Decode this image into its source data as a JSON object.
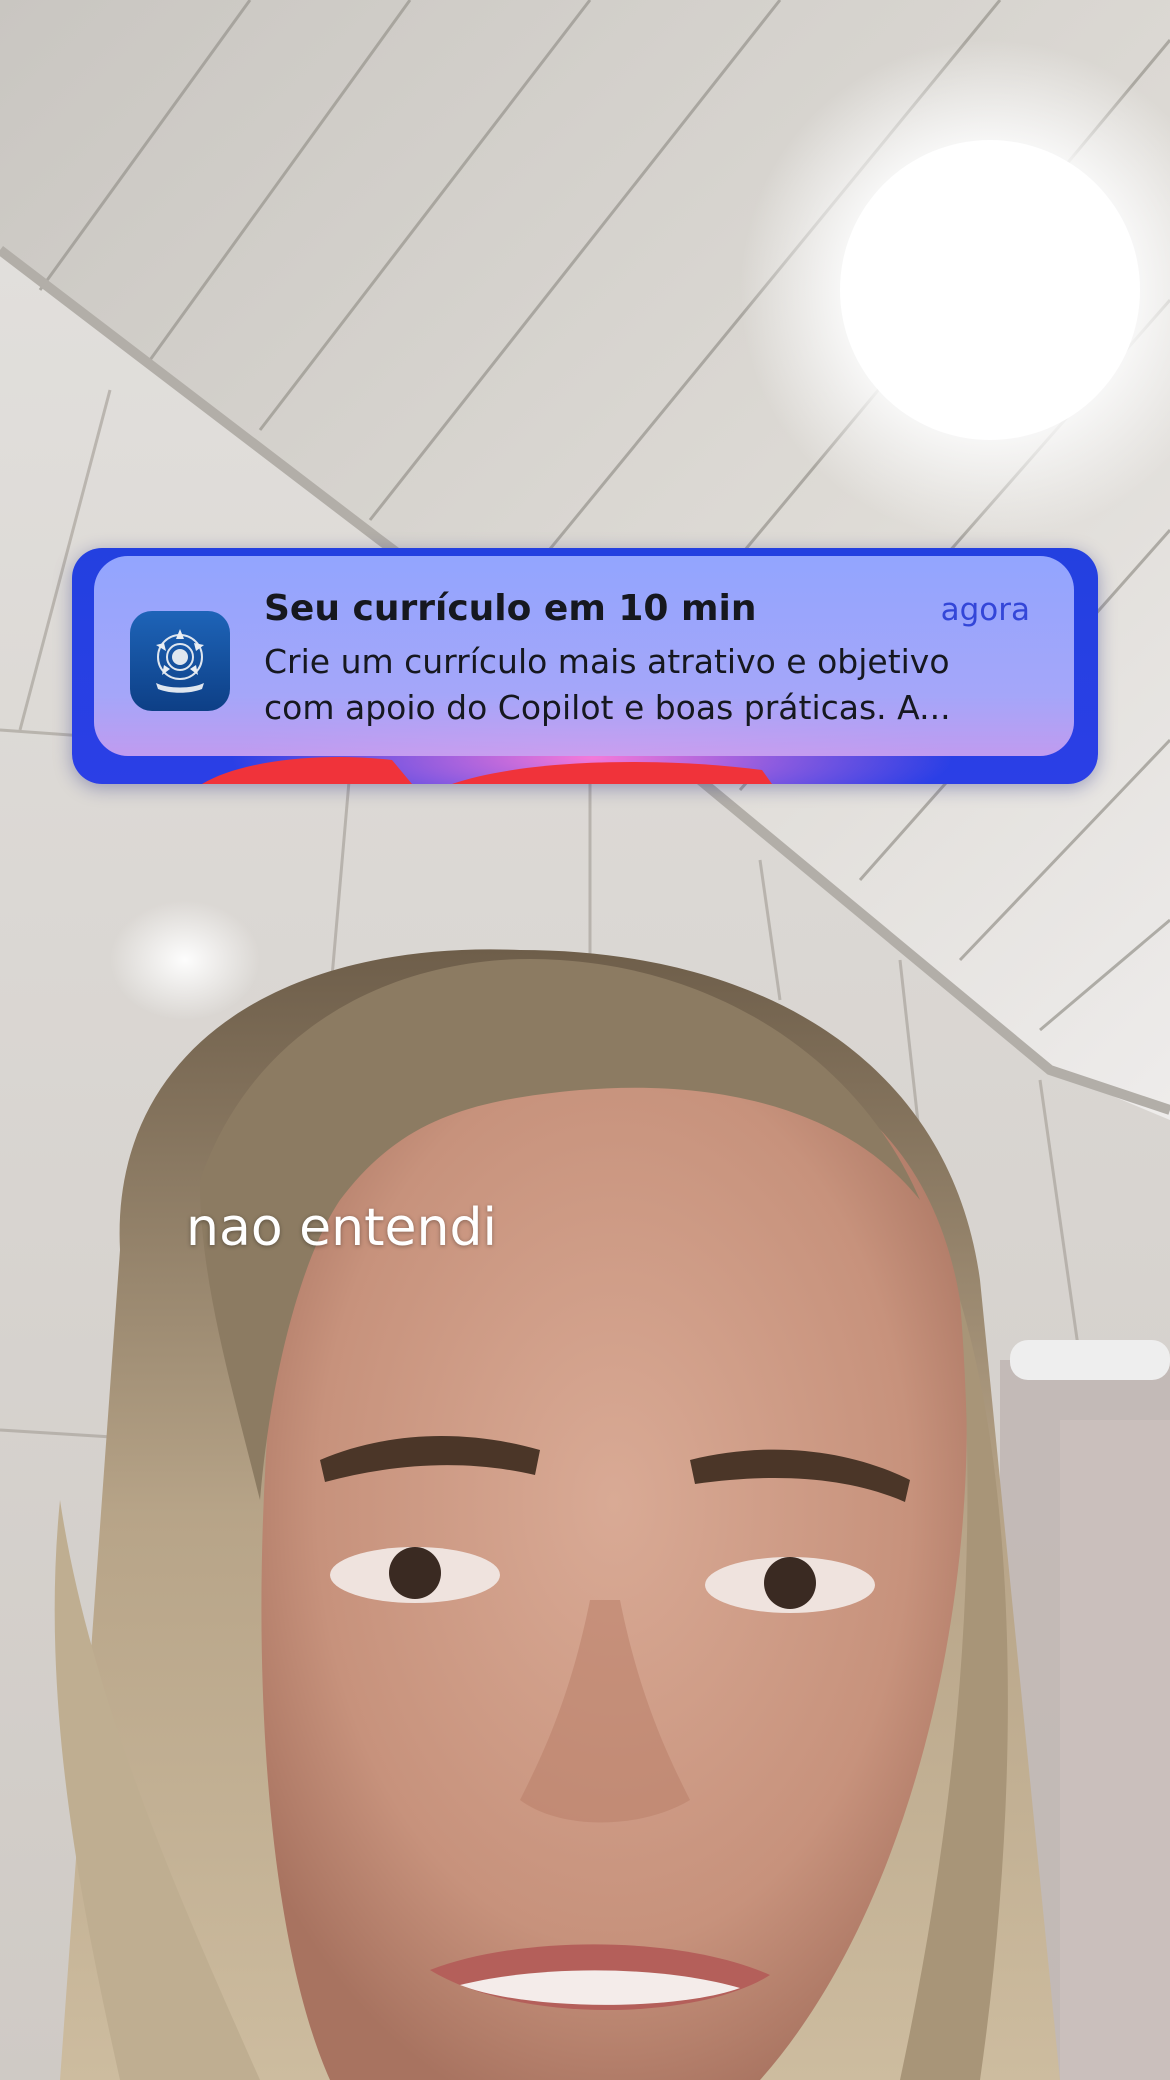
{
  "notification": {
    "app_icon": "coat-of-arms-icon",
    "title": "Seu currículo em 10 min",
    "time": "agora",
    "body_line1": "Crie um currículo mais atrativo e objetivo",
    "body_line2": "com apoio do Copilot e boas práticas. A..."
  },
  "caption": {
    "text": "nao entendi"
  },
  "colors": {
    "banner_frame": "#2340e0",
    "banner_card": "#96a8ff",
    "time_accent": "#3346d8",
    "caption_text": "#ffffff"
  }
}
